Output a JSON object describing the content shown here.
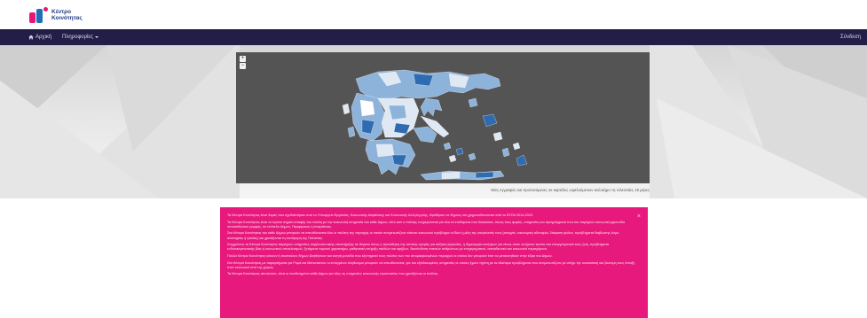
{
  "brand": {
    "line1": "Κέντρο",
    "line2": "Κοινότητας"
  },
  "nav": {
    "home": "Αρχική",
    "info": "Πληροφορίες",
    "login": "Σύνδεση",
    "home_icon": "home-icon",
    "caret_icon": "caret-down-icon"
  },
  "map": {
    "zoom_in": "+",
    "zoom_out": "−",
    "caption": "Νέες εγγραφές και προτεινόμενες σε καρτέλες ωφελούμενων ανά Δήμο τις τελευταίες 15 μέρες",
    "colors": {
      "panel": "#545454",
      "light": "#dfe8f3",
      "mid": "#8db3da",
      "dark": "#2f6bb0"
    }
  },
  "info": {
    "close": "×",
    "paragraphs": [
      "Τα Κέντρα Κοινότητας είναι δομές που σχεδιάστηκαν από το Υπουργείο Εργασίας, Κοινωνικής Ασφάλισης και Κοινωνικής Αλληλεγγύης, ιδρύθηκαν σε δήμους και χρηματοδοτούνται από το ΕΣΠΑ 2014-2020.",
      "Τα Κέντρα Κοινότητας είναι το πρώτο σημείο επαφής του πολίτη με την κοινωνική υπηρεσία του κάθε Δήμου. Από εκεί ο πολίτης ενημερώνεται για όλα τα επιδόματα που δικαιούται, όλους τους φορείς, υπηρεσίες και προγράμματα που του παρέχουν κοινωνική φροντίδα οποιασδήποτε μορφής, σε επίπεδο Δήμου, Περιφέρειας ή επικράτειας.",
      "Στα Κέντρα Κοινότητας του κάθε Δήμου μπορούν να απευθύνονται όλοι οι πολίτες της περιοχής οι οποίοι αντιμετωπίζουν κάποιο κοινωνικό πρόβλημα οι ίδιοι ή μέλη της οικογένειάς τους (ανεργία, οικονομική αδυναμία, διάκριση φύλου, προβλήματα διαβίωσης λόγω αναπηρίας ή ηλικίας) και χρειάζονται τη συνδρομή της Πολιτείας.",
      "Συγχρόνως τα Κέντρα Κοινότητας παρέχουν υπηρεσίες συμβουλευτικής υποστήριξης σε θέματα όπως η προώθηση της τοπικής αγοράς για αύξηση εργασίας, η δημιουργία κινήτρων για νέους ώστε να βρουν τρόπο στο επαγγελματικό τους ζωή, προβλήματα ενδοοικογενειακής βίας ή κοινωνικού αποκλεισμού, ζητήματα νομικού χαρακτήρα, μαθησιακή στήριξη παιδιών και εφήβων, διασύνδεση τοπικών ανθρώπων με επιχειρηματικό, εκπαιδευτικό και κοινωνικό περιεχόμενο.",
      "Πολλά Κέντρα Κοινότητας κάνουν ή σκοπεύουν δήμων βοηθήσουν και κινητή μονάδα που εξυπηρετεί τους πολίτες των πιο απομακρυσμένων περιοχών οι οποίοι δεν μπορούν έτσι να μετακινηθούν στην έδρα του Δήμου.",
      "Στα Κέντρα Κοινότητας με παραρτήματα για Ρομά και Μεταναστών οι ενταγμένοι πληθυσμοί μπορούν να απευθύνονται, για πιο εξειδικευμένες υπηρεσίες οι οποίες έχουν σχέση με τα ιδιαίτερα προβλήματα που αντιμετωπίζουν με στόχο την ουσιαστική και βιώσιμη τους ένταξη στον κοινωνικό ιστό της χώρας.",
      "Τα Κέντρα Κοινότητας αποτελούν, είναι οι αναθετημένοι κάθε Δήμου για όλες τις υπηρεσίες κοινωνικής προστασίας που χρειάζονται οι πολίτες."
    ]
  }
}
